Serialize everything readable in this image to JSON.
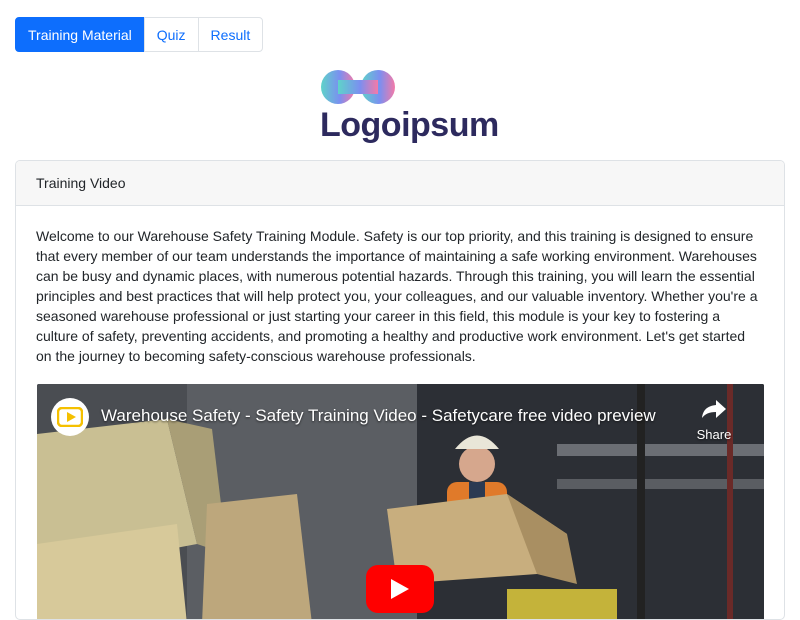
{
  "tabs": [
    {
      "label": "Training Material",
      "active": true
    },
    {
      "label": "Quiz",
      "active": false
    },
    {
      "label": "Result",
      "active": false
    }
  ],
  "logo": {
    "text": "Logoipsum",
    "colors": [
      "#5fd3c9",
      "#7b8ff0",
      "#f47aa8"
    ]
  },
  "card": {
    "header": "Training Video",
    "description": "Welcome to our Warehouse Safety Training Module. Safety is our top priority, and this training is designed to ensure that every member of our team understands the importance of maintaining a safe working environment. Warehouses can be busy and dynamic places, with numerous potential hazards. Through this training, you will learn the essential principles and best practices that will help protect you, your colleagues, and our valuable inventory. Whether you're a seasoned warehouse professional or just starting your career in this field, this module is your key to fostering a culture of safety, preventing accidents, and promoting a healthy and productive work environment. Let's get started on the journey to becoming safety-conscious warehouse professionals."
  },
  "video": {
    "title": "Warehouse Safety - Safety Training Video - Safetycare free video preview",
    "share_label": "Share",
    "play_color": "#ff0000"
  },
  "colors": {
    "primary": "#0d6efd",
    "logo_text": "#2d2a5e"
  }
}
